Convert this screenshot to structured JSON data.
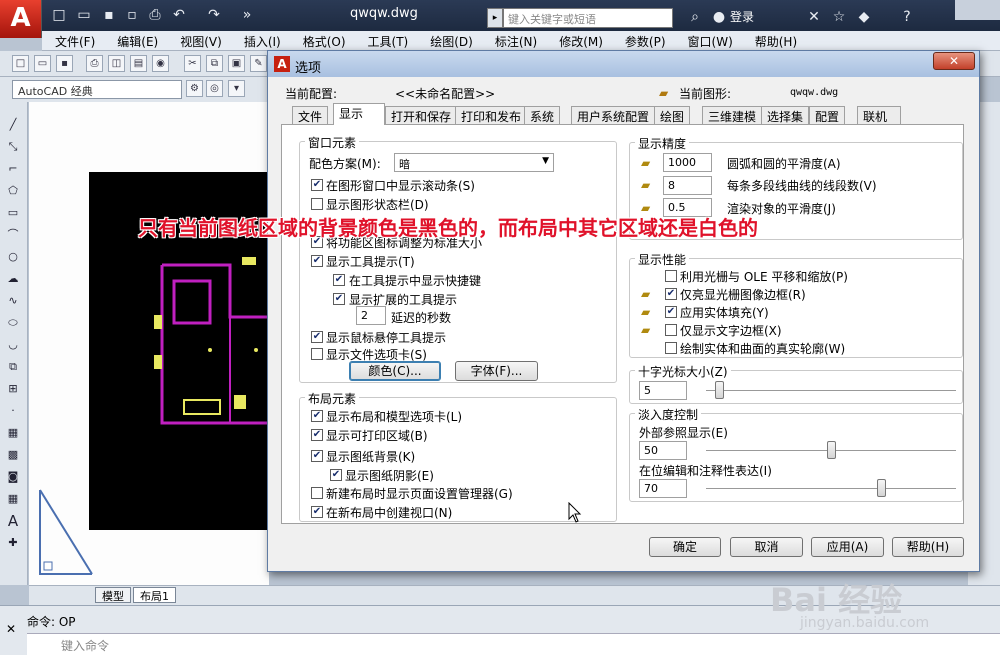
{
  "app": {
    "file_title": "qwqw.dwg",
    "search_placeholder": "键入关键字或短语",
    "login": "登录",
    "workspace": "AutoCAD 经典"
  },
  "menu": [
    "文件(F)",
    "编辑(E)",
    "视图(V)",
    "插入(I)",
    "格式(O)",
    "工具(T)",
    "绘图(D)",
    "标注(N)",
    "修改(M)",
    "参数(P)",
    "窗口(W)",
    "帮助(H)"
  ],
  "layout_tabs": [
    "模型",
    "布局1"
  ],
  "command": {
    "history": "命令: OP",
    "placeholder": "键入命令"
  },
  "annotation": "只有当前图纸区域的背景颜色是黑色的，而布局中其它区域还是白色的",
  "dialog": {
    "title": "选项",
    "current_profile_label": "当前配置:",
    "current_profile_value": "<<未命名配置>>",
    "current_drawing_label": "当前图形:",
    "current_drawing_value": "qwqw.dwg",
    "tabs": [
      "文件",
      "显示",
      "打开和保存",
      "打印和发布",
      "系统",
      "用户系统配置",
      "绘图",
      "三维建模",
      "选择集",
      "配置",
      "联机"
    ],
    "window_elements": {
      "title": "窗口元素",
      "scheme_label": "配色方案(M):",
      "scheme_value": "暗",
      "items": [
        "在图形窗口中显示滚动条(S)",
        "显示图形状态栏(D)",
        "将功能区图标调整为标准大小",
        "显示工具提示(T)",
        "在工具提示中显示快捷键",
        "显示扩展的工具提示",
        "延迟的秒数",
        "显示鼠标悬停工具提示",
        "显示文件选项卡(S)"
      ],
      "delay_value": "2",
      "colors_button": "颜色(C)...",
      "fonts_button": "字体(F)..."
    },
    "layout_elements": {
      "title": "布局元素",
      "items": [
        "显示布局和模型选项卡(L)",
        "显示可打印区域(B)",
        "显示图纸背景(K)",
        "显示图纸阴影(E)",
        "新建布局时显示页面设置管理器(G)",
        "在新布局中创建视口(N)"
      ]
    },
    "resolution": {
      "title": "显示精度",
      "items": [
        {
          "value": "1000",
          "label": "圆弧和圆的平滑度(A)"
        },
        {
          "value": "8",
          "label": "每条多段线曲线的线段数(V)"
        },
        {
          "value": "0.5",
          "label": "渲染对象的平滑度(J)"
        }
      ]
    },
    "performance": {
      "title": "显示性能",
      "items": [
        "利用光栅与 OLE 平移和缩放(P)",
        "仅亮显光栅图像边框(R)",
        "应用实体填充(Y)",
        "仅显示文字边框(X)",
        "绘制实体和曲面的真实轮廓(W)"
      ]
    },
    "crosshair": {
      "title": "十字光标大小(Z)",
      "value": "5",
      "percent": 5
    },
    "fade": {
      "title": "淡入度控制",
      "xref_label": "外部参照显示(E)",
      "xref_value": "50",
      "xref_percent": 50,
      "inplace_label": "在位编辑和注释性表达(I)",
      "inplace_value": "70",
      "inplace_percent": 70
    },
    "buttons": {
      "ok": "确定",
      "cancel": "取消",
      "apply": "应用(A)",
      "help": "帮助(H)"
    }
  },
  "watermark": {
    "brand": "Bai 经验",
    "url": "jingyan.baidu.com"
  }
}
